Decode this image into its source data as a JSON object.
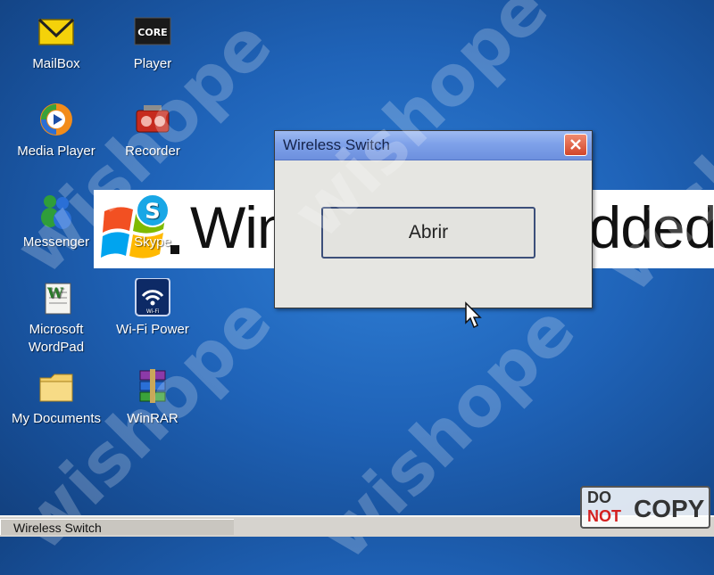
{
  "desktop": {
    "banner_text": "Windows Embedded CE",
    "icons": [
      {
        "label": "MailBox",
        "icon": "mailbox-icon"
      },
      {
        "label": "Player",
        "icon": "core-player-icon",
        "badge": "CORE"
      },
      {
        "label": "Media Player",
        "icon": "media-player-icon"
      },
      {
        "label": "Recorder",
        "icon": "recorder-icon"
      },
      {
        "label": "Messenger",
        "icon": "messenger-icon"
      },
      {
        "label": "Skype",
        "icon": "skype-icon"
      },
      {
        "label": "Microsoft WordPad",
        "icon": "wordpad-icon"
      },
      {
        "label": "Wi-Fi Power",
        "icon": "wifi-power-icon",
        "badge": "Wi-Fi"
      },
      {
        "label": "My Documents",
        "icon": "folder-icon"
      },
      {
        "label": "WinRAR",
        "icon": "winrar-icon"
      }
    ]
  },
  "dialog": {
    "title": "Wireless Switch",
    "close_icon": "close-icon",
    "open_button_label": "Abrir"
  },
  "taskbar": {
    "items": [
      {
        "label": "Wireless Switch"
      }
    ]
  },
  "watermark": {
    "text": "wishope",
    "stamp_do": "DO",
    "stamp_not": "NOT",
    "stamp_copy": "COPY"
  },
  "colors": {
    "desktop_blue": "#1f63b8",
    "titlebar": "#7ea1e9",
    "close_red": "#d2462a"
  }
}
